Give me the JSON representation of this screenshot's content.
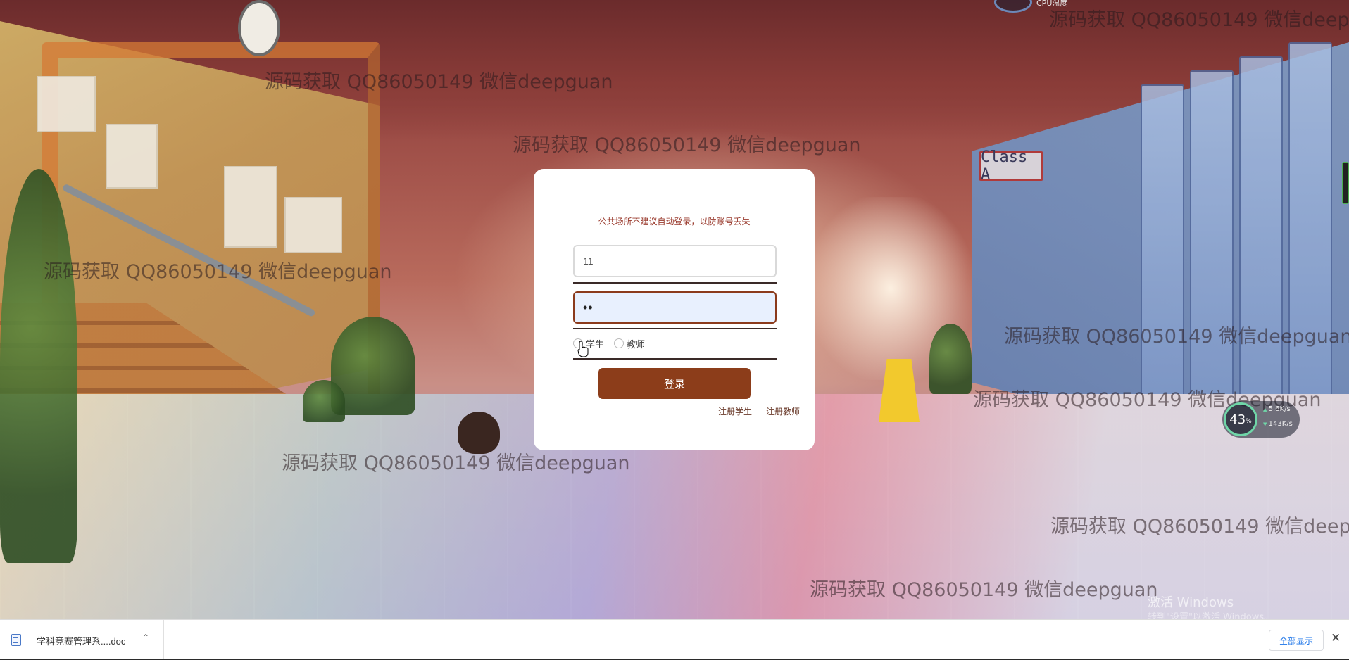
{
  "background": {
    "class_sign": "Class A"
  },
  "watermark_text": "源码获取 QQ86050149 微信deepguan",
  "login": {
    "notice": "公共场所不建议自动登录，以防账号丢失",
    "username_value": "11",
    "password_value": "••",
    "roles": [
      {
        "label": "学生",
        "selected": false
      },
      {
        "label": "教师",
        "selected": false
      }
    ],
    "login_button": "登录",
    "register_student": "注册学生",
    "register_teacher": "注册教师"
  },
  "overlay": {
    "cpu_label": "CPU温度",
    "net_percent": "43",
    "net_percent_unit": "%",
    "net_up": "5.6K/s",
    "net_down": "143K/s",
    "activate_title": "激活 Windows",
    "activate_hint": "转到\"设置\"以激活 Windows。"
  },
  "download_bar": {
    "file_name": "学科竞赛管理系....doc",
    "show_all": "全部显示",
    "icons": [
      "doc-icon",
      "chevron-up-icon",
      "close-icon"
    ]
  },
  "colors": {
    "primary_button": "#8c3d1a",
    "notice_text": "#9a3b2e",
    "autofill_bg": "#e8f0fe"
  }
}
